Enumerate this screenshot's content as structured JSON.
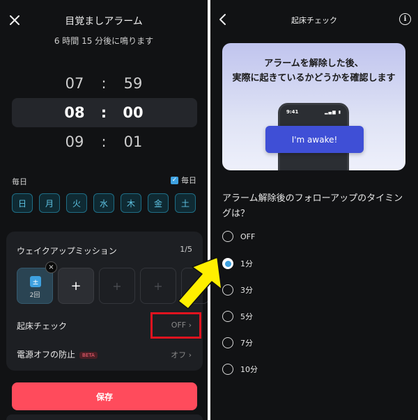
{
  "left": {
    "title": "目覚ましアラーム",
    "subtitle": "6 時間 15 分後に鳴ります",
    "time_rows": [
      {
        "hour": "07",
        "minute": "59"
      },
      {
        "hour": "08",
        "minute": "00"
      },
      {
        "hour": "09",
        "minute": "01"
      }
    ],
    "time_separator": ":",
    "repeat_label": "毎日",
    "every_day_checkbox": {
      "label": "毎日",
      "checked": true
    },
    "days": [
      "日",
      "月",
      "火",
      "水",
      "木",
      "金",
      "土"
    ],
    "wake_mission": {
      "title": "ウェイクアップミッション",
      "count": "1/5",
      "active_slot_count": "2回",
      "remove_glyph": "×",
      "add_glyph": "+"
    },
    "wake_check": {
      "label": "起床チェック",
      "value": "OFF"
    },
    "power_off": {
      "label": "電源オフの防止",
      "badge": "BETA",
      "value": "オフ"
    },
    "save_label": "保存"
  },
  "right": {
    "title": "起床チェック",
    "hero": {
      "line1": "アラームを解除した後、",
      "line2": "実際に起きているかどうかを確認します",
      "phone_time": "9:41",
      "button_label": "I'm awake!"
    },
    "question": "アラーム解除後のフォローアップのタイミングは？",
    "options": [
      {
        "label": "OFF",
        "selected": false
      },
      {
        "label": "1分",
        "selected": true
      },
      {
        "label": "3分",
        "selected": false
      },
      {
        "label": "5分",
        "selected": false
      },
      {
        "label": "7分",
        "selected": false
      },
      {
        "label": "10分",
        "selected": false
      }
    ]
  },
  "colors": {
    "accent_blue": "#3ea1e0",
    "save_red": "#ff4b5c",
    "highlight_red": "#e0131f",
    "arrow_yellow": "#ffef00",
    "awake_button": "#3f4fd6"
  }
}
